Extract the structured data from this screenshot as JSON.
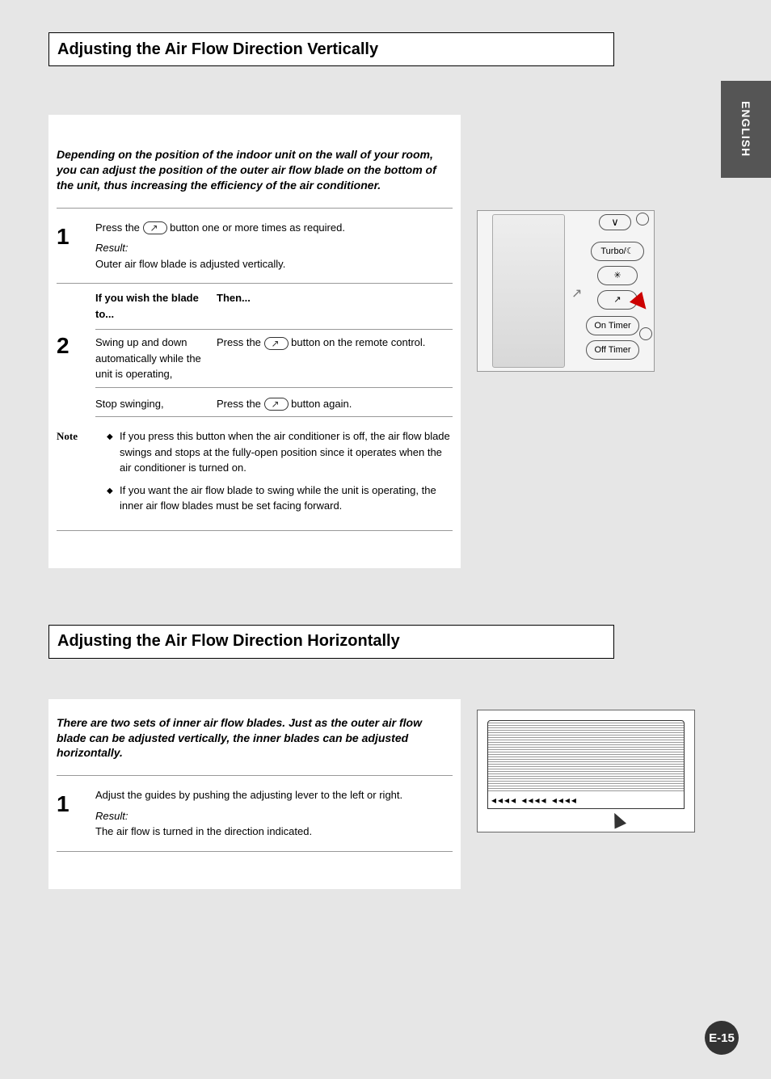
{
  "sideTab": "ENGLISH",
  "pageNumber": "E-15",
  "section1": {
    "title": "Adjusting the Air Flow Direction Vertically",
    "intro": "Depending on the position of the indoor unit on the wall of your room, you can adjust the position of the outer air flow blade on the bottom of the unit, thus increasing the efficiency of the air conditioner.",
    "step1": {
      "num": "1",
      "lead": "Press the",
      "tail": "button one or more times as required.",
      "resultLabel": "Result:",
      "resultText": "Outer air flow blade is adjusted vertically.",
      "condCol": "If you wish the blade to...",
      "thenCol": "Then...",
      "row1a": "Swing up and down automatically while the unit is operating,",
      "row1b": "Press the",
      "row1c": "button on the remote control.",
      "row2a": "Stop swinging,",
      "row2b": "Press the",
      "row2c": "button again."
    },
    "noteLabel": "Note",
    "noteBullets": [
      "If you press this button when the air conditioner is off, the air flow blade swings and stops at the fully-open position since it operates when the air conditioner is turned on.",
      "If you want the air flow blade to swing while the unit is operating, the inner air flow blades must be set facing forward."
    ],
    "remote": {
      "btnV": "∨",
      "btnTurbo": "Turbo/",
      "btnFan": "✳",
      "btnSwing": "↗",
      "btnOnTimer": "On Timer",
      "btnOffTimer": "Off Timer"
    }
  },
  "section2": {
    "title": "Adjusting the Air Flow Direction Horizontally",
    "intro": "There are two sets of inner air flow blades. Just as the outer air flow blade can be adjusted vertically, the inner blades can be adjusted horizontally.",
    "step1": {
      "num": "1",
      "text": "Adjust the guides by pushing the adjusting lever to the left or right.",
      "resultLabel": "Result:",
      "resultText": "The air flow is turned in the direction indicated."
    }
  }
}
